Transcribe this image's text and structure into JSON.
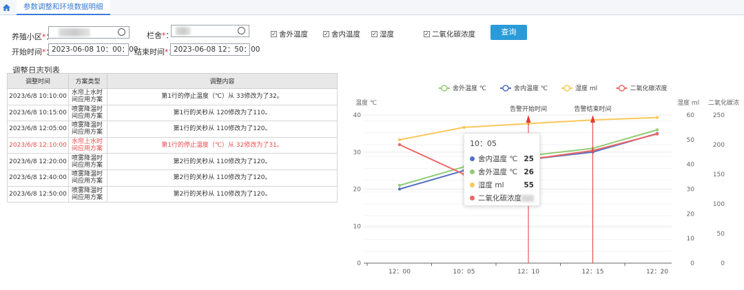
{
  "nav": {
    "home_icon": "home-icon",
    "tab": "参数调整和环境数据明细"
  },
  "form": {
    "farm_label": "养殖小区",
    "barn_label": "栏舍",
    "start_label": "开始时间",
    "end_label": "结束时间",
    "required_mark": "*",
    "colon": "：",
    "start_value": "2023-06-08 10：00：00",
    "end_value": "2023-06-08 12：50：00",
    "checkboxes": [
      {
        "label": "舍外温度",
        "checked": true
      },
      {
        "label": "舍内温度",
        "checked": true
      },
      {
        "label": "湿度",
        "checked": true
      },
      {
        "label": "二氧化碳浓度",
        "checked": true
      }
    ],
    "check_mark": "✓",
    "query_button": "查询"
  },
  "log": {
    "title": "调整日志列表",
    "headers": [
      "调整时间",
      "方案类型",
      "调整内容"
    ],
    "rows": [
      {
        "time": "2023/6/8 10:10:00",
        "type": "水帘上水时间应用方案",
        "content": "第1行的停止温度（℃）从 33修改为了32。",
        "highlight": false
      },
      {
        "time": "2023/6/8 10:15:00",
        "type": "喷雾降温时间应用方案",
        "content": "第1行的关秒从 120修改为了110。",
        "highlight": false
      },
      {
        "time": "2023/6/8 12:05:00",
        "type": "喷雾降温时间应用方案",
        "content": "第1行的关秒从 110修改为了120。",
        "highlight": false
      },
      {
        "time": "2023/6/8 12:10:00",
        "type": "水帘上水时间应用方案",
        "content": "第1行的停止温度（℃）从 32修改为了31。",
        "highlight": true
      },
      {
        "time": "2023/6/8 12:20:00",
        "type": "喷雾降温时间应用方案",
        "content": "第2行的关秒从 110修改为了120。",
        "highlight": false
      },
      {
        "time": "2023/6/8 12:40:00",
        "type": "喷雾降温时间应用方案",
        "content": "第2行的关秒从 110修改为了120。",
        "highlight": false
      },
      {
        "time": "2023/6/8 12:50:00",
        "type": "喷雾降温时间应用方案",
        "content": "第2行的关秒从 110修改为了120。",
        "highlight": false
      }
    ]
  },
  "chart_data": {
    "type": "line",
    "x": [
      "12：00",
      "10：05",
      "12：10",
      "12：15",
      "12：20"
    ],
    "y_axes": [
      {
        "label": "温度 ℃",
        "ticks": [
          0,
          10,
          20,
          30,
          40
        ],
        "range": [
          0,
          40
        ]
      },
      {
        "label": "湿度 ml",
        "ticks": [
          0,
          10,
          20,
          30,
          40,
          50,
          60
        ],
        "range": [
          0,
          60
        ]
      },
      {
        "label": "二氧化碳浓",
        "ticks": [
          0,
          50,
          100,
          150,
          200,
          250
        ],
        "range": [
          0,
          250
        ]
      }
    ],
    "series": [
      {
        "name": "舍外温度 ℃",
        "color": "#91cc75",
        "axis": 0,
        "values": [
          21,
          26,
          29,
          31,
          36
        ]
      },
      {
        "name": "舍内温度 ℃",
        "color": "#5470c6",
        "axis": 0,
        "values": [
          20,
          25,
          28,
          30,
          35
        ]
      },
      {
        "name": "湿度 ml",
        "color": "#fac858",
        "axis": 1,
        "values": [
          50,
          55,
          56.5,
          58,
          59
        ]
      },
      {
        "name": "二氧化碳浓度",
        "color": "#ee6666",
        "axis": 2,
        "values": [
          200,
          150,
          175,
          190,
          218
        ]
      }
    ],
    "markers": [
      {
        "label": "告警开始时间",
        "x": "12：10"
      },
      {
        "label": "告警结束时间",
        "x": "12：15"
      }
    ],
    "legend": "top-center",
    "tooltip": {
      "title": "10：05",
      "items": [
        {
          "name": "舍内温度 ℃",
          "value": "25",
          "color": "#5470c6"
        },
        {
          "name": "舍外温度 ℃",
          "value": "26",
          "color": "#91cc75"
        },
        {
          "name": "湿度 ml",
          "value": "55",
          "color": "#fac858"
        },
        {
          "name": "二氧化碳浓度",
          "value": "",
          "color": "#ee6666"
        }
      ]
    }
  }
}
